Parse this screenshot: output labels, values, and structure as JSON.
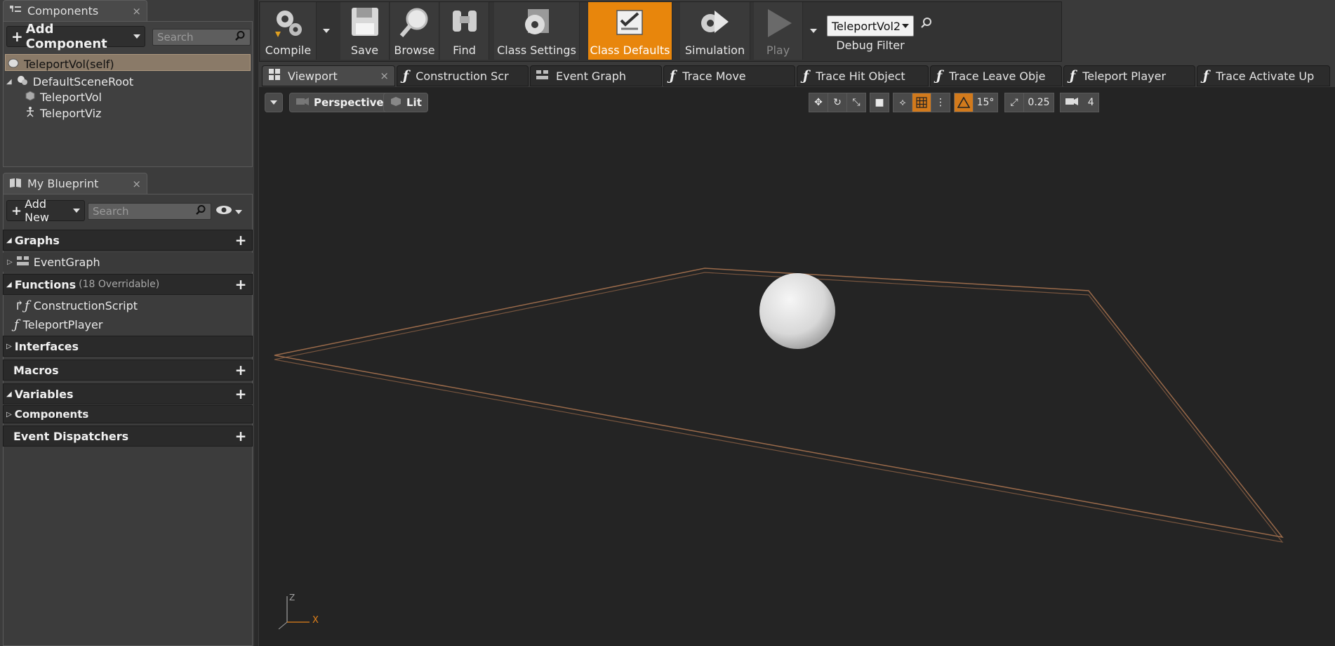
{
  "components_panel": {
    "tab_title": "Components",
    "tab_close": "×",
    "add_component_label": "Add Component",
    "search_placeholder": "Search",
    "self_item": "TeleportVol(self)",
    "tree": [
      {
        "label": "DefaultSceneRoot"
      },
      {
        "label": "TeleportVol"
      },
      {
        "label": "TeleportViz"
      }
    ]
  },
  "my_blueprint_panel": {
    "tab_title": "My Blueprint",
    "tab_close": "×",
    "add_new_label": "Add New",
    "search_placeholder": "Search",
    "sections": {
      "graphs": {
        "label": "Graphs",
        "items": [
          "EventGraph"
        ]
      },
      "functions": {
        "label": "Functions",
        "sublabel": "(18 Overridable)",
        "items": [
          "ConstructionScript",
          "TeleportPlayer"
        ]
      },
      "interfaces": {
        "label": "Interfaces"
      },
      "macros": {
        "label": "Macros"
      },
      "variables": {
        "label": "Variables"
      },
      "components": {
        "label": "Components"
      },
      "event_dispatchers": {
        "label": "Event Dispatchers"
      }
    }
  },
  "toolbar": {
    "compile": "Compile",
    "save": "Save",
    "browse": "Browse",
    "find": "Find",
    "class_settings": "Class Settings",
    "class_defaults": "Class Defaults",
    "simulation": "Simulation",
    "play": "Play",
    "debug_object": "TeleportVol2",
    "debug_filter": "Debug Filter"
  },
  "editor_tabs": [
    {
      "label": "Viewport",
      "close": "×"
    },
    {
      "label": "Construction Scr"
    },
    {
      "label": "Event Graph"
    },
    {
      "label": "Trace Move"
    },
    {
      "label": "Trace Hit Object"
    },
    {
      "label": "Trace Leave Obje"
    },
    {
      "label": "Teleport Player"
    },
    {
      "label": "Trace Activate Up"
    }
  ],
  "viewport": {
    "perspective_label": "Perspective",
    "lit_label": "Lit",
    "rotation_snap": "15°",
    "scale_snap": "0.25",
    "camera_speed": "4",
    "axis_z": "Z",
    "axis_x": "X"
  },
  "colors": {
    "accent": "#e8860c",
    "volume_outline": "#a07050"
  }
}
